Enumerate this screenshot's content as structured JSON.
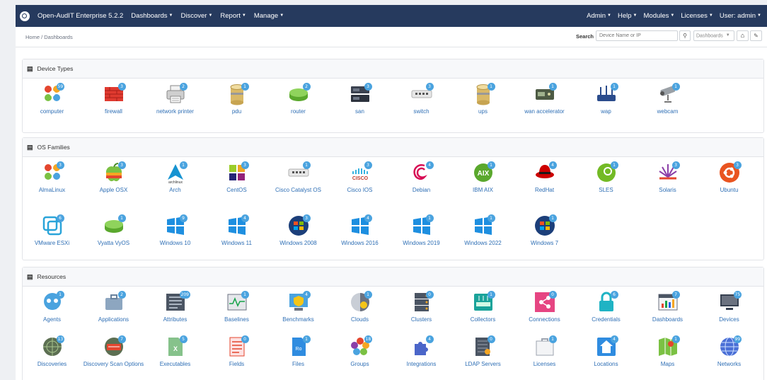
{
  "navbar": {
    "brand": "Open-AudIT Enterprise 5.2.2",
    "left_menu": [
      "Dashboards",
      "Discover",
      "Report",
      "Manage"
    ],
    "right_menu": [
      "Admin",
      "Help",
      "Modules",
      "Licenses",
      "User: admin"
    ]
  },
  "breadcrumb": "Home / Dashboards",
  "search": {
    "label": "Search",
    "placeholder": "Device Name or IP",
    "dashboard_select": "Dashboards"
  },
  "sections": {
    "device_types": {
      "title": "Device Types",
      "items": [
        {
          "label": "computer",
          "count": "59",
          "icon": "pinwheel-icon"
        },
        {
          "label": "firewall",
          "count": "3",
          "icon": "firewall-icon"
        },
        {
          "label": "network printer",
          "count": "2",
          "icon": "printer-icon"
        },
        {
          "label": "pdu",
          "count": "1",
          "icon": "cylinder-icon"
        },
        {
          "label": "router",
          "count": "2",
          "icon": "router-icon"
        },
        {
          "label": "san",
          "count": "3",
          "icon": "storage-icon"
        },
        {
          "label": "switch",
          "count": "3",
          "icon": "switch-icon"
        },
        {
          "label": "ups",
          "count": "1",
          "icon": "cylinder-icon"
        },
        {
          "label": "wan accelerator",
          "count": "1",
          "icon": "appliance-icon"
        },
        {
          "label": "wap",
          "count": "1",
          "icon": "wap-icon"
        },
        {
          "label": "webcam",
          "count": "1",
          "icon": "camera-icon"
        }
      ]
    },
    "os_families": {
      "title": "OS Families",
      "items": [
        {
          "label": "AlmaLinux",
          "count": "3",
          "icon": "pinwheel-icon"
        },
        {
          "label": "Apple OSX",
          "count": "3",
          "icon": "apple-icon"
        },
        {
          "label": "Arch",
          "count": "1",
          "icon": "arch-icon"
        },
        {
          "label": "CentOS",
          "count": "3",
          "icon": "centos-icon"
        },
        {
          "label": "Cisco Catalyst OS",
          "count": "1",
          "icon": "switch-icon"
        },
        {
          "label": "Cisco IOS",
          "count": "3",
          "icon": "cisco-icon"
        },
        {
          "label": "Debian",
          "count": "4",
          "icon": "debian-icon"
        },
        {
          "label": "IBM AIX",
          "count": "1",
          "icon": "aix-icon"
        },
        {
          "label": "RedHat",
          "count": "4",
          "icon": "redhat-icon"
        },
        {
          "label": "SLES",
          "count": "1",
          "icon": "sles-icon"
        },
        {
          "label": "Solaris",
          "count": "3",
          "icon": "solaris-icon"
        },
        {
          "label": "Ubuntu",
          "count": "3",
          "icon": "ubuntu-icon"
        },
        {
          "label": "VMware ESXi",
          "count": "6",
          "icon": "vmware-icon"
        },
        {
          "label": "Vyatta VyOS",
          "count": "1",
          "icon": "router-icon"
        },
        {
          "label": "Windows 10",
          "count": "9",
          "icon": "windows-icon"
        },
        {
          "label": "Windows 11",
          "count": "4",
          "icon": "windows-icon"
        },
        {
          "label": "Windows 2008",
          "count": "3",
          "icon": "windows-orb-icon"
        },
        {
          "label": "Windows 2016",
          "count": "4",
          "icon": "windows-icon"
        },
        {
          "label": "Windows 2019",
          "count": "1",
          "icon": "windows-icon"
        },
        {
          "label": "Windows 2022",
          "count": "1",
          "icon": "windows-icon"
        },
        {
          "label": "Windows 7",
          "count": "1",
          "icon": "windows-orb-icon"
        }
      ]
    },
    "resources": {
      "title": "Resources",
      "items": [
        {
          "label": "Agents",
          "count": "1",
          "icon": "agent-icon"
        },
        {
          "label": "Applications",
          "count": "2",
          "icon": "briefcase-icon"
        },
        {
          "label": "Attributes",
          "count": "209",
          "icon": "attributes-icon"
        },
        {
          "label": "Baselines",
          "count": "1",
          "icon": "baseline-icon"
        },
        {
          "label": "Benchmarks",
          "count": "4",
          "icon": "benchmark-icon"
        },
        {
          "label": "Clouds",
          "count": "1",
          "icon": "cloud-icon"
        },
        {
          "label": "Clusters",
          "count": "0",
          "icon": "cluster-icon"
        },
        {
          "label": "Collectors",
          "count": "1",
          "icon": "collector-icon"
        },
        {
          "label": "Connections",
          "count": "0",
          "icon": "share-icon"
        },
        {
          "label": "Credentials",
          "count": "6",
          "icon": "padlock-icon"
        },
        {
          "label": "Dashboards",
          "count": "7",
          "icon": "dashboard-icon"
        },
        {
          "label": "Devices",
          "count": "75",
          "icon": "monitor-icon"
        },
        {
          "label": "Discoveries",
          "count": "13",
          "icon": "radar-icon"
        },
        {
          "label": "Discovery Scan Options",
          "count": "7",
          "icon": "scan-icon"
        },
        {
          "label": "Executables",
          "count": "5",
          "icon": "executable-icon"
        },
        {
          "label": "Fields",
          "count": "0",
          "icon": "fields-icon"
        },
        {
          "label": "Files",
          "count": "1",
          "icon": "file-icon"
        },
        {
          "label": "Groups",
          "count": "18",
          "icon": "groups-icon"
        },
        {
          "label": "Integrations",
          "count": "4",
          "icon": "puzzle-icon"
        },
        {
          "label": "LDAP Servers",
          "count": "0",
          "icon": "ldap-icon"
        },
        {
          "label": "Licenses",
          "count": "1",
          "icon": "license-icon"
        },
        {
          "label": "Locations",
          "count": "4",
          "icon": "location-icon"
        },
        {
          "label": "Maps",
          "count": "1",
          "icon": "map-icon"
        },
        {
          "label": "Networks",
          "count": "99",
          "icon": "globe-icon"
        }
      ]
    }
  },
  "colors": {
    "navbar": "#263a5e",
    "link": "#2f6fb5",
    "badge": "#4aa3df"
  }
}
